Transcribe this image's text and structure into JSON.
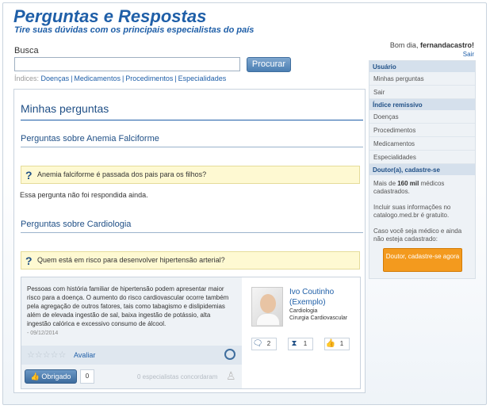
{
  "header": {
    "title": "Perguntas e Respostas",
    "subtitle": "Tire suas dúvidas com os principais especialistas do país"
  },
  "search": {
    "label": "Busca",
    "value": "",
    "button": "Procurar",
    "indices_label": "Índices:",
    "indices": [
      "Doenças",
      "Medicamentos",
      "Procedimentos",
      "Especialidades"
    ]
  },
  "user": {
    "greeting": "Bom dia,",
    "username": "fernandacastro!",
    "logout": "Sair"
  },
  "sidebar": {
    "usuario_head": "Usuário",
    "usuario_items": [
      "Minhas perguntas",
      "Sair"
    ],
    "indice_head": "Índice remissivo",
    "indice_items": [
      "Doenças",
      "Procedimentos",
      "Medicamentos",
      "Especialidades"
    ],
    "doutor_head": "Doutor(a), cadastre-se",
    "doutor_text1_pre": "Mais de ",
    "doutor_text1_bold": "160 mil",
    "doutor_text1_post": " médicos cadastrados.",
    "doutor_text2": "Incluir suas informações no catalogo.med.br é gratuito.",
    "doutor_text3": "Caso você seja médico e ainda não esteja cadastrado:",
    "cta": "Doutor, cadastre-se agora"
  },
  "main": {
    "title": "Minhas perguntas",
    "sections": [
      {
        "title": "Perguntas sobre Anemia Falciforme",
        "question": "Anemia falciforme é passada dos pais para os filhos?",
        "no_answer": "Essa pergunta não foi respondida ainda."
      },
      {
        "title": "Perguntas sobre Cardiologia",
        "question": "Quem está em risco para desenvolver hipertensão arterial?"
      }
    ],
    "answer": {
      "text": "Pessoas com história familiar de hipertensão podem apresentar maior risco para a doença. O aumento do risco cardiovascular ocorre também pela agregação de outros fatores, tais como tabagismo e dislipidemias além de elevada ingestão de sal, baixa ingestão de potássio, alta ingestão calórica e excessivo consumo de álcool.",
      "date": "- 09/12/2014",
      "rate_label": "Avaliar",
      "thanks_label": "Obrigado",
      "thanks_count": "0",
      "agree_text": "0 especialistas concordaram",
      "doctor_name": "Ivo Coutinho (Exemplo)",
      "doctor_spec1": "Cardiologia",
      "doctor_spec2": "Cirurgia Cardiovascular",
      "stats": [
        {
          "icon": "chat-icon",
          "value": "2"
        },
        {
          "icon": "hourglass-icon",
          "value": "1"
        },
        {
          "icon": "thumbs-up-icon",
          "value": "1"
        }
      ]
    }
  }
}
